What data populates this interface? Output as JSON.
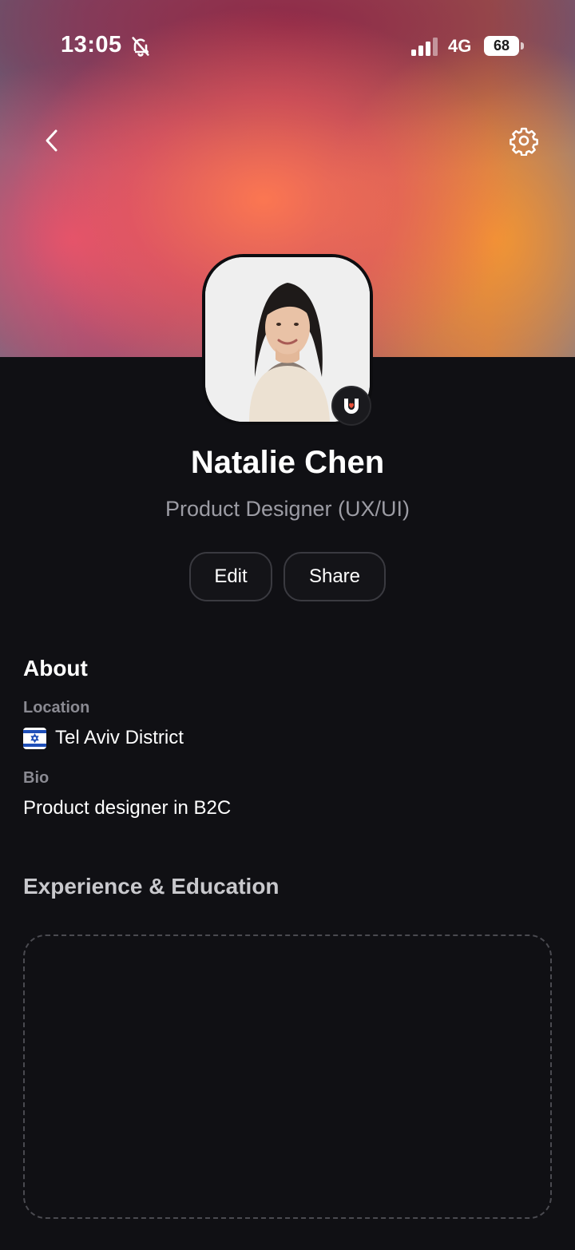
{
  "status_bar": {
    "time": "13:05",
    "network": "4G",
    "battery": "68"
  },
  "profile": {
    "name": "Natalie Chen",
    "headline": "Product Designer (UX/UI)"
  },
  "actions": {
    "edit_label": "Edit",
    "share_label": "Share"
  },
  "about": {
    "title": "About",
    "location_label": "Location",
    "location_value": "Tel Aviv District",
    "bio_label": "Bio",
    "bio_value": "Product designer in B2C"
  },
  "experience": {
    "title": "Experience & Education"
  },
  "icons": {
    "back": "chevron-left-icon",
    "settings": "gear-icon",
    "mute": "bell-off-icon",
    "badge": "app-logo-badge-icon",
    "flag": "israel-flag-icon"
  },
  "colors": {
    "background": "#101014",
    "muted_text": "#9c9ca4",
    "badge_accent": "#e8503a",
    "flag_blue": "#1f4fb8"
  }
}
